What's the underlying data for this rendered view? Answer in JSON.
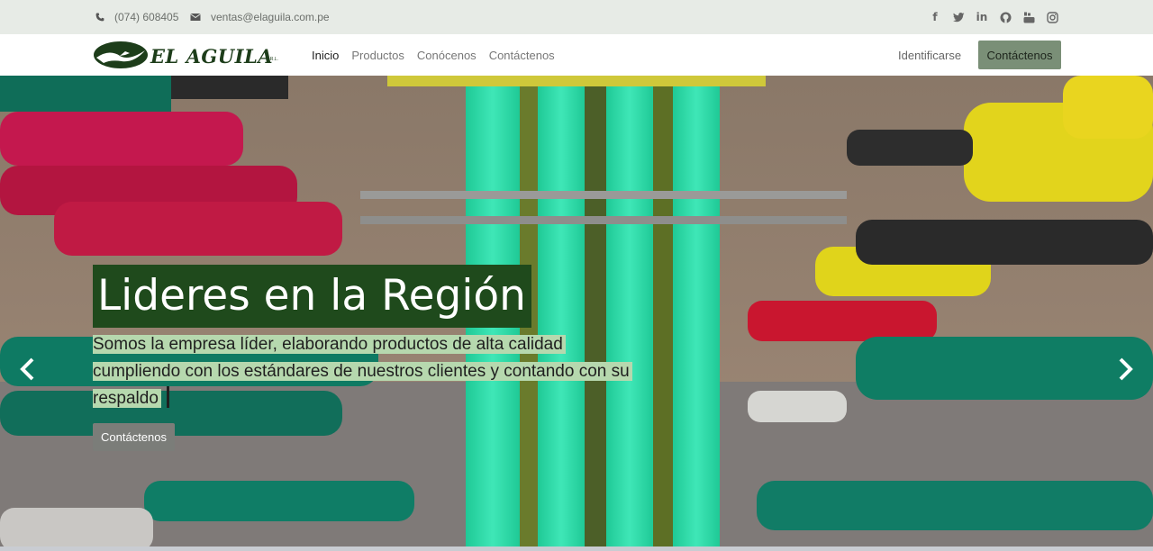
{
  "topbar": {
    "phone": "(074) 608405",
    "email": "ventas@elaguila.com.pe",
    "social_icons": [
      "facebook-icon",
      "twitter-icon",
      "linkedin-icon",
      "github-icon",
      "youtube-icon",
      "instagram-icon"
    ]
  },
  "nav": {
    "logo_text": "EL AGUILA",
    "logo_suffix": "S.R.L.",
    "items": [
      {
        "label": "Inicio",
        "active": true
      },
      {
        "label": "Productos",
        "active": false
      },
      {
        "label": "Conócenos",
        "active": false
      },
      {
        "label": "Contáctenos",
        "active": false
      }
    ],
    "login_label": "Identificarse",
    "cta_label": "Contáctenos"
  },
  "hero": {
    "title": "Lideres en la Región",
    "subtitle": " Somos la empresa líder, elaborando productos de alta calidad cumpliendo con los estándares de nuestros clientes y contando con su respaldo",
    "button_label": "Contáctenos"
  },
  "colors": {
    "topbar_bg": "#e7ebe6",
    "brand_green": "#1f4a1c",
    "cta_bg": "#7a8f77",
    "subtitle_highlight": "#b6d8ae"
  }
}
